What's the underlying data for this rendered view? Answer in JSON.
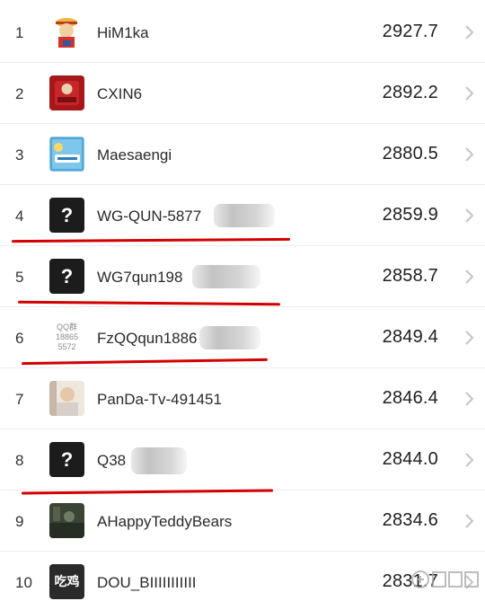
{
  "leaderboard": {
    "rows": [
      {
        "rank": "1",
        "name": "HiM1ka",
        "score": "2927.7",
        "avatar": "cartoon-pirate-icon"
      },
      {
        "rank": "2",
        "name": "CXIN6",
        "score": "2892.2",
        "avatar": "red-badge-icon"
      },
      {
        "rank": "3",
        "name": "Maesaengi",
        "score": "2880.5",
        "avatar": "cartoon-panel-icon"
      },
      {
        "rank": "4",
        "name": "WG-QUN-5877",
        "score": "2859.9",
        "avatar": "question-mark-icon"
      },
      {
        "rank": "5",
        "name": "WG7qun198",
        "score": "2858.7",
        "avatar": "question-mark-icon",
        "avatar_text": "?"
      },
      {
        "rank": "6",
        "name": "FzQQqun1886",
        "score": "2849.4",
        "avatar": "qq-group-text-icon",
        "avatar_lines": [
          "QQ群",
          "18865",
          "5572"
        ]
      },
      {
        "rank": "7",
        "name": "PanDa-Tv-491451",
        "score": "2846.4",
        "avatar": "photo-avatar-icon"
      },
      {
        "rank": "8",
        "name": "Q38",
        "score": "2844.0",
        "avatar": "question-mark-icon",
        "avatar_text": "?"
      },
      {
        "rank": "9",
        "name": "AHappyTeddyBears",
        "score": "2834.6",
        "avatar": "dark-photo-avatar-icon"
      },
      {
        "rank": "10",
        "name": "DOU_BIIIIIIIIIII",
        "score": "2831.7",
        "avatar": "chiji-text-icon",
        "avatar_text": "吃鸡"
      }
    ],
    "question_mark": "?"
  },
  "watermark": {
    "text": "游侠网"
  },
  "colors": {
    "underline": "#d40000",
    "divider": "#ececec",
    "chevron": "#c4c4c4",
    "qmark_bg": "#1c1c1c"
  }
}
